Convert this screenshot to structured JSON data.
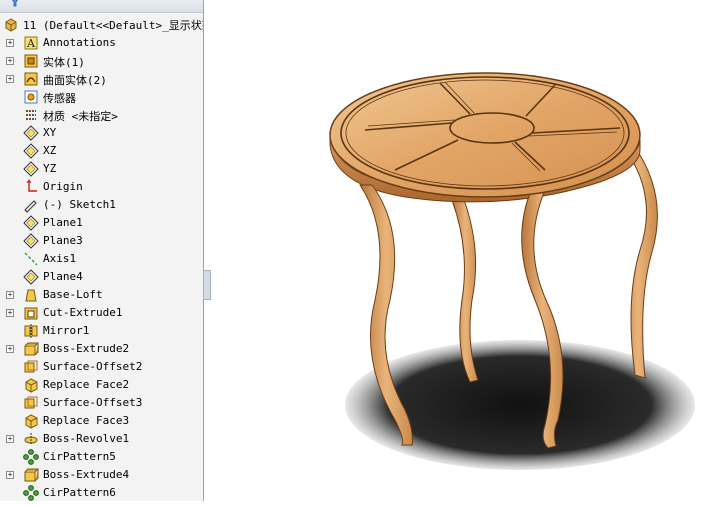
{
  "tree": {
    "root_label": "11  (Default<<Default>_显示状态",
    "items": [
      {
        "label": "Annotations",
        "icon": "annotations-icon",
        "exp": true
      },
      {
        "label": "实体(1)",
        "icon": "solid-bodies-icon",
        "exp": true
      },
      {
        "label": "曲面实体(2)",
        "icon": "surface-bodies-icon",
        "exp": true
      },
      {
        "label": "传感器",
        "icon": "sensors-icon",
        "exp": false
      },
      {
        "label": "材质 <未指定>",
        "icon": "material-icon",
        "exp": false
      },
      {
        "label": "XY",
        "icon": "plane-icon",
        "exp": false
      },
      {
        "label": "XZ",
        "icon": "plane-icon",
        "exp": false
      },
      {
        "label": "YZ",
        "icon": "plane-icon",
        "exp": false
      },
      {
        "label": "Origin",
        "icon": "origin-icon",
        "exp": false
      },
      {
        "label": "(-) Sketch1",
        "icon": "sketch-icon",
        "exp": false
      },
      {
        "label": "Plane1",
        "icon": "plane-icon",
        "exp": false
      },
      {
        "label": "Plane3",
        "icon": "plane-icon",
        "exp": false
      },
      {
        "label": "Axis1",
        "icon": "axis-icon",
        "exp": false
      },
      {
        "label": "Plane4",
        "icon": "plane-icon",
        "exp": false
      },
      {
        "label": "Base-Loft",
        "icon": "loft-icon",
        "exp": true
      },
      {
        "label": "Cut-Extrude1",
        "icon": "cut-extrude-icon",
        "exp": true
      },
      {
        "label": "Mirror1",
        "icon": "mirror-icon",
        "exp": false
      },
      {
        "label": "Boss-Extrude2",
        "icon": "boss-extrude-icon",
        "exp": true
      },
      {
        "label": "Surface-Offset2",
        "icon": "surface-offset-icon",
        "exp": false
      },
      {
        "label": "Replace Face2",
        "icon": "replace-face-icon",
        "exp": false
      },
      {
        "label": "Surface-Offset3",
        "icon": "surface-offset-icon",
        "exp": false
      },
      {
        "label": "Replace Face3",
        "icon": "replace-face-icon",
        "exp": false
      },
      {
        "label": "Boss-Revolve1",
        "icon": "revolve-icon",
        "exp": true
      },
      {
        "label": "CirPattern5",
        "icon": "circular-pattern-icon",
        "exp": false
      },
      {
        "label": "Boss-Extrude4",
        "icon": "boss-extrude-icon",
        "exp": true
      },
      {
        "label": "CirPattern6",
        "icon": "circular-pattern-icon",
        "exp": false
      }
    ]
  },
  "model_view": {
    "object": "round-table-model"
  }
}
